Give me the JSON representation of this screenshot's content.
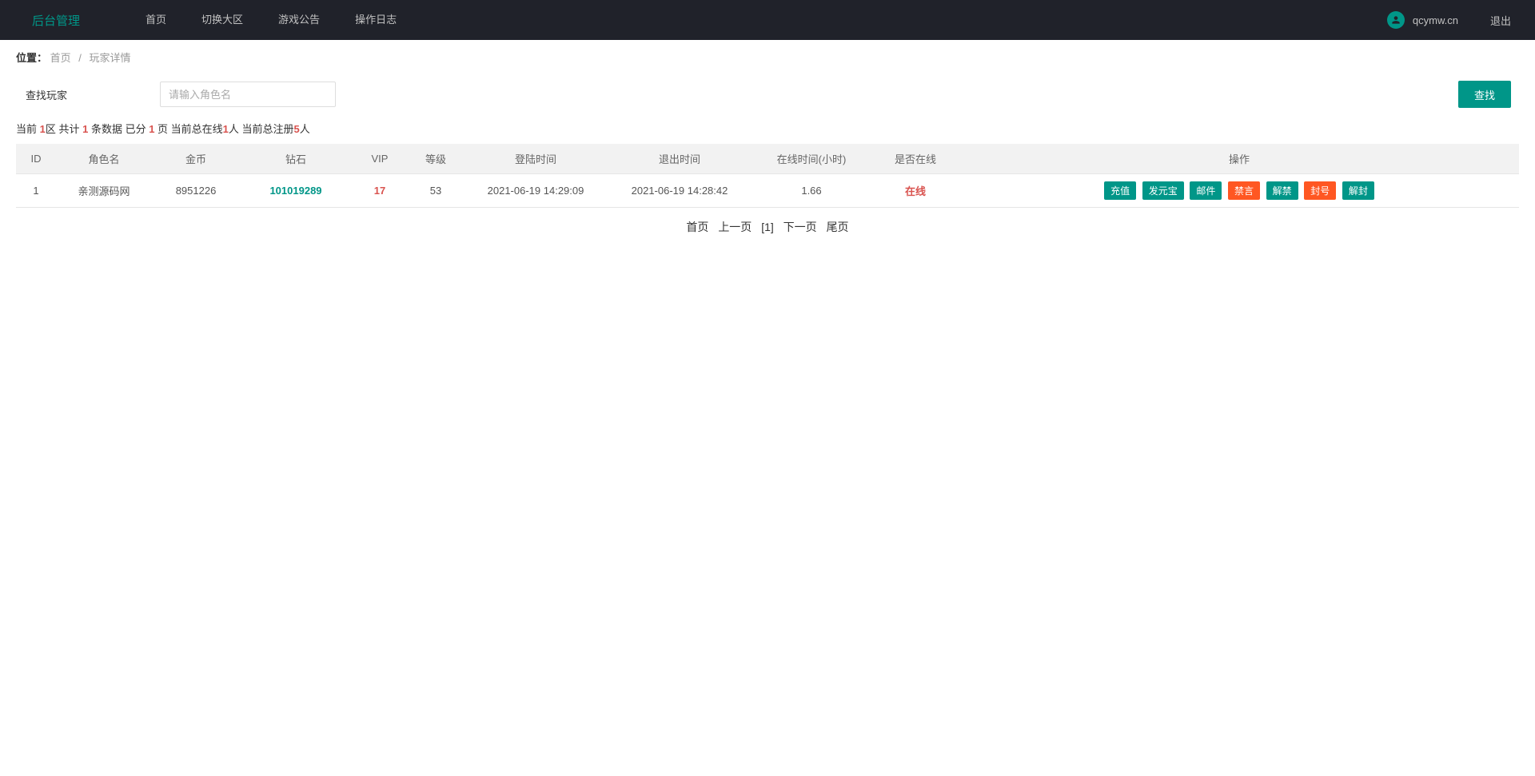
{
  "nav": {
    "brand": "后台管理",
    "items": [
      "首页",
      "切换大区",
      "游戏公告",
      "操作日志"
    ],
    "username": "qcymw.cn",
    "logout": "退出"
  },
  "breadcrumb": {
    "label": "位置：",
    "home": "首页",
    "current": "玩家详情"
  },
  "search": {
    "label": "查找玩家",
    "placeholder": "请输入角色名",
    "button": "查找"
  },
  "stats": {
    "prefix": "当前 ",
    "zone": "1",
    "zone_suffix": "区",
    "total_prefix": " 共计 ",
    "total": "1",
    "total_suffix": " 条数据 已分 ",
    "pages": "1",
    "pages_suffix": " 页 当前总在线",
    "online": "1",
    "online_suffix": "人  当前总注册",
    "registered": "5",
    "registered_suffix": "人"
  },
  "table": {
    "headers": [
      "ID",
      "角色名",
      "金币",
      "钻石",
      "VIP",
      "等级",
      "登陆时间",
      "退出时间",
      "在线时间(小时)",
      "是否在线",
      "操作"
    ],
    "rows": [
      {
        "id": "1",
        "name": "亲测源码网",
        "gold": "8951226",
        "diamond": "101019289",
        "vip": "17",
        "level": "53",
        "login_time": "2021-06-19 14:29:09",
        "logout_time": "2021-06-19 14:28:42",
        "online_time": "1.66",
        "is_online": "在线"
      }
    ],
    "actions": [
      {
        "label": "充值",
        "cls": "btn-teal"
      },
      {
        "label": "发元宝",
        "cls": "btn-teal"
      },
      {
        "label": "邮件",
        "cls": "btn-teal"
      },
      {
        "label": "禁言",
        "cls": "btn-orange"
      },
      {
        "label": "解禁",
        "cls": "btn-teal"
      },
      {
        "label": "封号",
        "cls": "btn-orange"
      },
      {
        "label": "解封",
        "cls": "btn-teal"
      }
    ]
  },
  "pagination": {
    "first": "首页",
    "prev": "上一页",
    "current": "[1]",
    "next": "下一页",
    "last": "尾页"
  }
}
